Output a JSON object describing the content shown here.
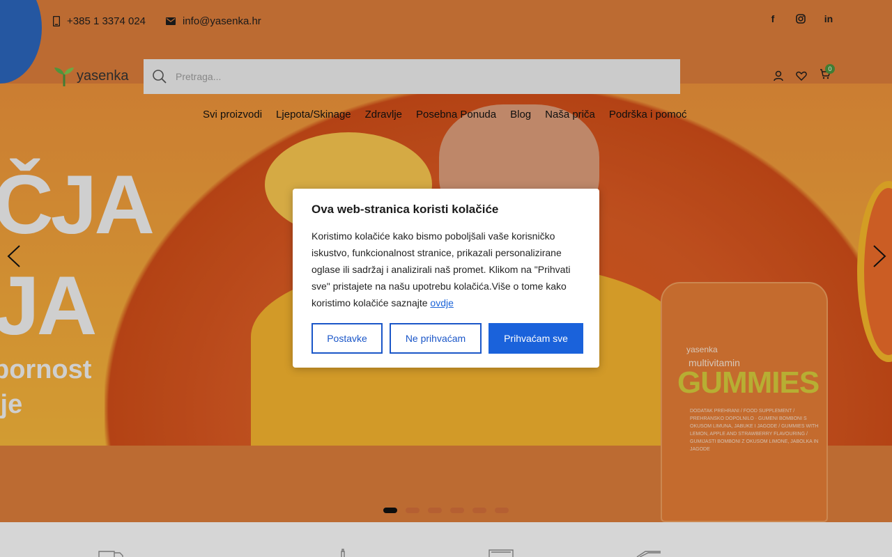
{
  "topbar": {
    "phone": "+385 1 3374 024",
    "email": "info@yasenka.hr",
    "social": [
      "facebook-icon",
      "instagram-icon",
      "linkedin-icon"
    ]
  },
  "header": {
    "logo_text": "yasenka",
    "search_placeholder": "Pretraga...",
    "cart_count": "0"
  },
  "nav": {
    "items": [
      "Svi proizvodi",
      "Ljepota/Skinage",
      "Zdravlje",
      "Posebna Ponuda",
      "Blog",
      "Naša priča",
      "Podrška i pomoć"
    ]
  },
  "hero": {
    "slogan_line1": "ČJA",
    "slogan_line2": "JA",
    "slogan_line3": "pornost",
    "slogan_line4": "ije",
    "jar_brand": "yasenka",
    "jar_sub": "multivitamin",
    "jar_title": "GUMMIES",
    "jar_text": "DODATAK PREHRANI / FOOD SUPPLEMENT / PREHRANSKO DOPOLNILO · GUMENI BOMBONI S OKUSOM LIMUNA, JABUKE I JAGODE / GUMMIES WITH LEMON, APPLE AND STRAWBERRY FLAVOURING / GUMIJASTI BOMBONI Z OKUSOM LIMONE, JABOLKA IN JAGODE",
    "slide_count": 6,
    "active_slide": 0
  },
  "cookie_modal": {
    "title": "Ova web-stranica koristi kolačiće",
    "body": "Koristimo kolačiće kako bismo poboljšali vaše korisničko iskustvo, funkcionalnost stranice, prikazali personalizirane oglase ili sadržaj i analizirali naš promet. Klikom na \"Prihvati sve\" pristajete na našu upotrebu kolačića.Više o tome kako koristimo kolačiće saznajte",
    "link": "ovdje",
    "buttons": {
      "settings": "Postavke",
      "decline": "Ne prihvaćam",
      "accept": "Prihvaćam sve"
    }
  },
  "colors": {
    "primary": "#1a62db",
    "brand_green": "#4b8f3c",
    "hero_orange": "#d77a3a"
  }
}
